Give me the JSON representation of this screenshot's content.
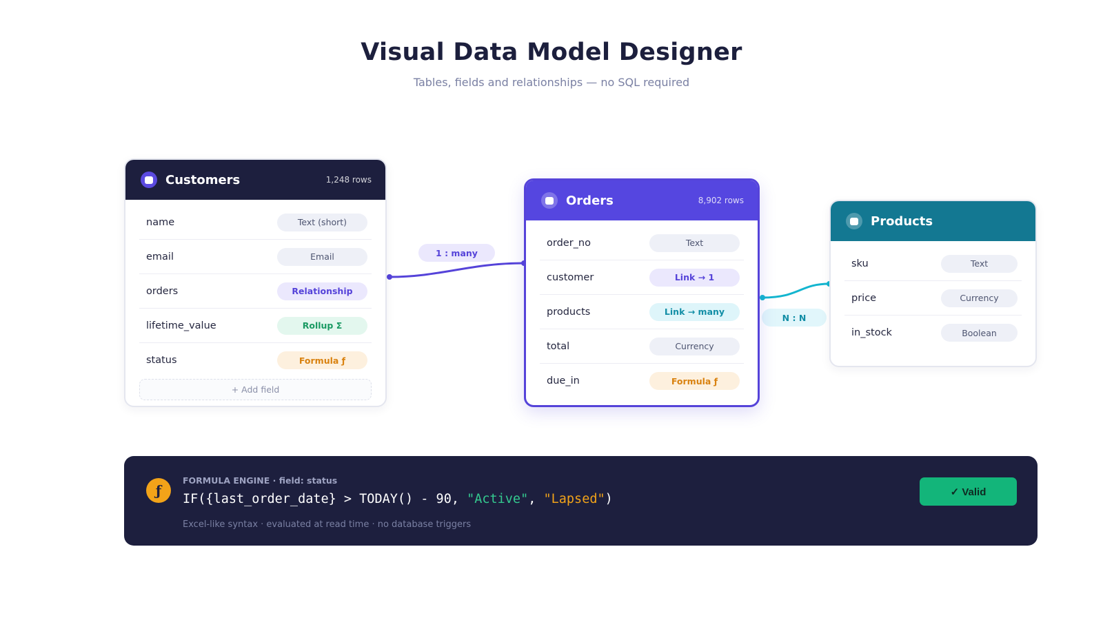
{
  "header": {
    "title": "Visual Data Model Designer",
    "subtitle": "Tables, fields and relationships — no SQL required"
  },
  "tables": {
    "customers": {
      "name": "Customers",
      "rows": "1,248 rows",
      "header_color": "#1d1f3e",
      "icon": "table-icon",
      "fields": [
        {
          "name": "name",
          "type": "Text (short)"
        },
        {
          "name": "email",
          "type": "Email"
        },
        {
          "name": "orders",
          "type": "Relationship"
        },
        {
          "name": "lifetime_value",
          "type": "Rollup Σ"
        },
        {
          "name": "status",
          "type": "Formula ƒ"
        }
      ],
      "add_field_label": "+ Add field"
    },
    "orders": {
      "name": "Orders",
      "rows": "8,902 rows",
      "header_color": "#5546e0",
      "icon": "table-icon",
      "fields": [
        {
          "name": "order_no",
          "type": "Text"
        },
        {
          "name": "customer",
          "type": "Link → 1"
        },
        {
          "name": "products",
          "type": "Link → many"
        },
        {
          "name": "total",
          "type": "Currency"
        },
        {
          "name": "due_in",
          "type": "Formula ƒ"
        }
      ]
    },
    "products": {
      "name": "Products",
      "header_color": "#137892",
      "icon": "table-icon",
      "fields": [
        {
          "name": "sku",
          "type": "Text"
        },
        {
          "name": "price",
          "type": "Currency"
        },
        {
          "name": "in_stock",
          "type": "Boolean"
        }
      ]
    }
  },
  "relationships": [
    {
      "from": "Customers",
      "to": "Orders",
      "label": "1 : many",
      "color": "#5543d9"
    },
    {
      "from": "Orders",
      "to": "Products",
      "label": "N : N",
      "color": "#13b5cf"
    }
  ],
  "formula": {
    "icon": "ƒ",
    "caption": "FORMULA ENGINE · field: status",
    "code_prefix": "IF({last_order_date} > TODAY() - 90, ",
    "code_active": "\"Active\"",
    "code_sep": ", ",
    "code_lapsed": "\"Lapsed\"",
    "code_suffix": ")",
    "note": "Excel-like syntax · evaluated at read time · no database triggers",
    "valid_label": "✓ Valid"
  },
  "colors": {
    "accent": "#5543d9",
    "teal": "#137892",
    "valid": "#13b57a",
    "formula": "#f2a319"
  }
}
